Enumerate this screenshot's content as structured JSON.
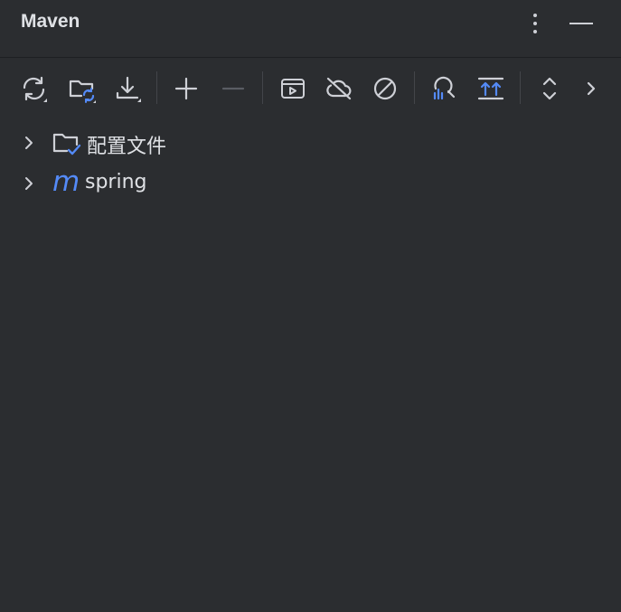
{
  "panel": {
    "title": "Maven",
    "more_icon": "vertical-ellipsis-icon",
    "minimize_icon": "minimize-icon"
  },
  "toolbar": {
    "buttons": [
      {
        "name": "reload-all-projects",
        "icon": "refresh-icon",
        "enabled": true
      },
      {
        "name": "generate-sources",
        "icon": "folder-refresh-icon",
        "enabled": true
      },
      {
        "name": "download-sources",
        "icon": "download-icon",
        "enabled": true
      },
      {
        "name": "add-maven-project",
        "icon": "plus-icon",
        "enabled": true
      },
      {
        "name": "remove-project",
        "icon": "minus-icon",
        "enabled": false
      },
      {
        "name": "execute-maven-goal",
        "icon": "run-goal-icon",
        "enabled": true
      },
      {
        "name": "toggle-offline-mode",
        "icon": "cloud-off-icon",
        "enabled": true
      },
      {
        "name": "skip-tests",
        "icon": "no-entry-icon",
        "enabled": true
      },
      {
        "name": "analyze-dependencies",
        "icon": "analyze-icon",
        "enabled": true
      },
      {
        "name": "show-dependencies",
        "icon": "dependencies-icon",
        "enabled": true
      },
      {
        "name": "expand-collapse",
        "icon": "expand-collapse-icon",
        "enabled": true
      },
      {
        "name": "more-actions",
        "icon": "chevron-right-icon",
        "enabled": true
      }
    ]
  },
  "tree": {
    "items": [
      {
        "label": "配置文件",
        "icon": "profiles-folder-icon",
        "expanded": false
      },
      {
        "label": "spring",
        "icon": "maven-module-icon",
        "icon_letter": "m",
        "expanded": false
      }
    ]
  },
  "colors": {
    "background": "#2b2d30",
    "text": "#dfe1e5",
    "icon": "#ced0d6",
    "icon_disabled": "#5a5d63",
    "accent": "#548af7"
  }
}
